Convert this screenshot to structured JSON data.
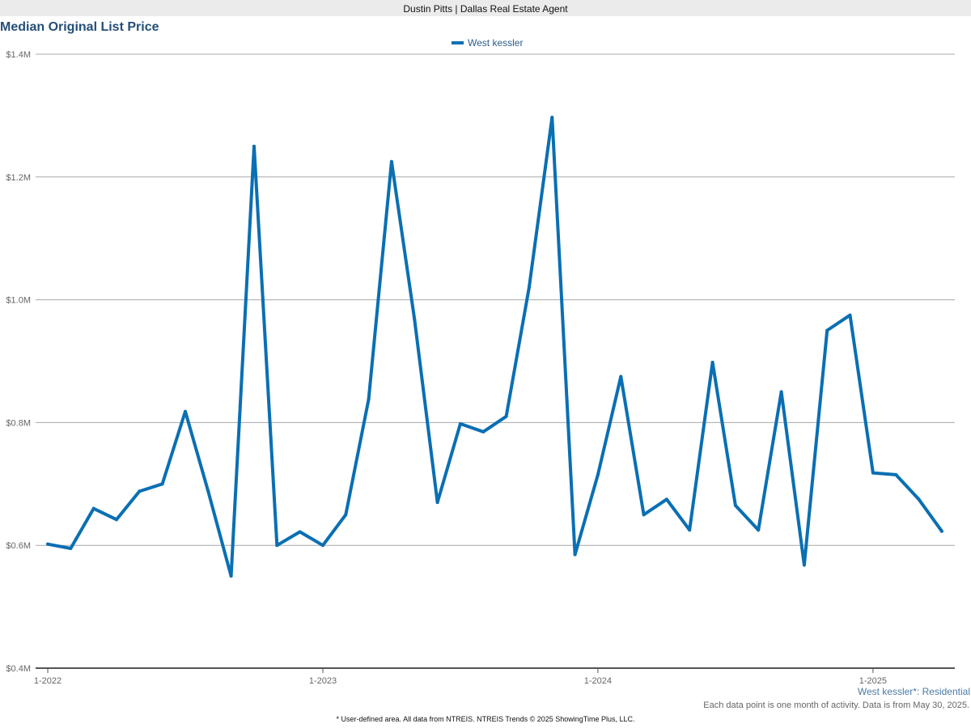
{
  "header": {
    "banner": "Dustin Pitts | Dallas Real Estate Agent"
  },
  "footer": {
    "series_label": "West kessler*: Residential",
    "note": "Each data point is one month of activity. Data is from May 30, 2025.",
    "source": "* User-defined area. All data from NTREIS. NTREIS Trends © 2025 ShowingTime Plus, LLC."
  },
  "colors": {
    "line": "#0a6fb3",
    "grid": "#a8a8a8",
    "axis": "#555555",
    "title": "#234f78"
  },
  "chart_data": {
    "type": "line",
    "title": "Median Original List Price",
    "xlabel": "",
    "ylabel": "",
    "ylim": [
      400000,
      1400000
    ],
    "y_ticks": [
      {
        "value": 400000,
        "label": "$0.4M"
      },
      {
        "value": 600000,
        "label": "$0.6M"
      },
      {
        "value": 800000,
        "label": "$0.8M"
      },
      {
        "value": 1000000,
        "label": "$1.0M"
      },
      {
        "value": 1200000,
        "label": "$1.2M"
      },
      {
        "value": 1400000,
        "label": "$1.4M"
      }
    ],
    "x_ticks": [
      {
        "month": "2022-01",
        "label": "1-2022"
      },
      {
        "month": "2023-01",
        "label": "1-2023"
      },
      {
        "month": "2024-01",
        "label": "1-2024"
      },
      {
        "month": "2025-01",
        "label": "1-2025"
      }
    ],
    "x_range": [
      "2022-01",
      "2025-05"
    ],
    "grid": true,
    "legend_position": "top-center",
    "series": [
      {
        "name": "West kessler",
        "color": "#0a6fb3",
        "x": [
          "2022-01",
          "2022-02",
          "2022-03",
          "2022-04",
          "2022-05",
          "2022-06",
          "2022-07",
          "2022-08",
          "2022-09",
          "2022-10",
          "2022-11",
          "2022-12",
          "2023-01",
          "2023-02",
          "2023-03",
          "2023-04",
          "2023-05",
          "2023-06",
          "2023-07",
          "2023-08",
          "2023-09",
          "2023-10",
          "2023-11",
          "2023-12",
          "2024-01",
          "2024-02",
          "2024-03",
          "2024-04",
          "2024-05",
          "2024-06",
          "2024-07",
          "2024-08",
          "2024-09",
          "2024-10",
          "2024-11",
          "2024-12",
          "2025-01",
          "2025-02",
          "2025-03",
          "2025-04"
        ],
        "values": [
          602000,
          595000,
          660000,
          642000,
          688000,
          700000,
          818000,
          688000,
          550000,
          1250000,
          600000,
          622000,
          600000,
          650000,
          838000,
          1225000,
          968000,
          670000,
          798000,
          785000,
          810000,
          1020000,
          1297000,
          585000,
          715000,
          875000,
          650000,
          675000,
          625000,
          898000,
          665000,
          625000,
          850000,
          568000,
          950000,
          975000,
          718000,
          715000,
          675000,
          623000
        ]
      }
    ]
  }
}
